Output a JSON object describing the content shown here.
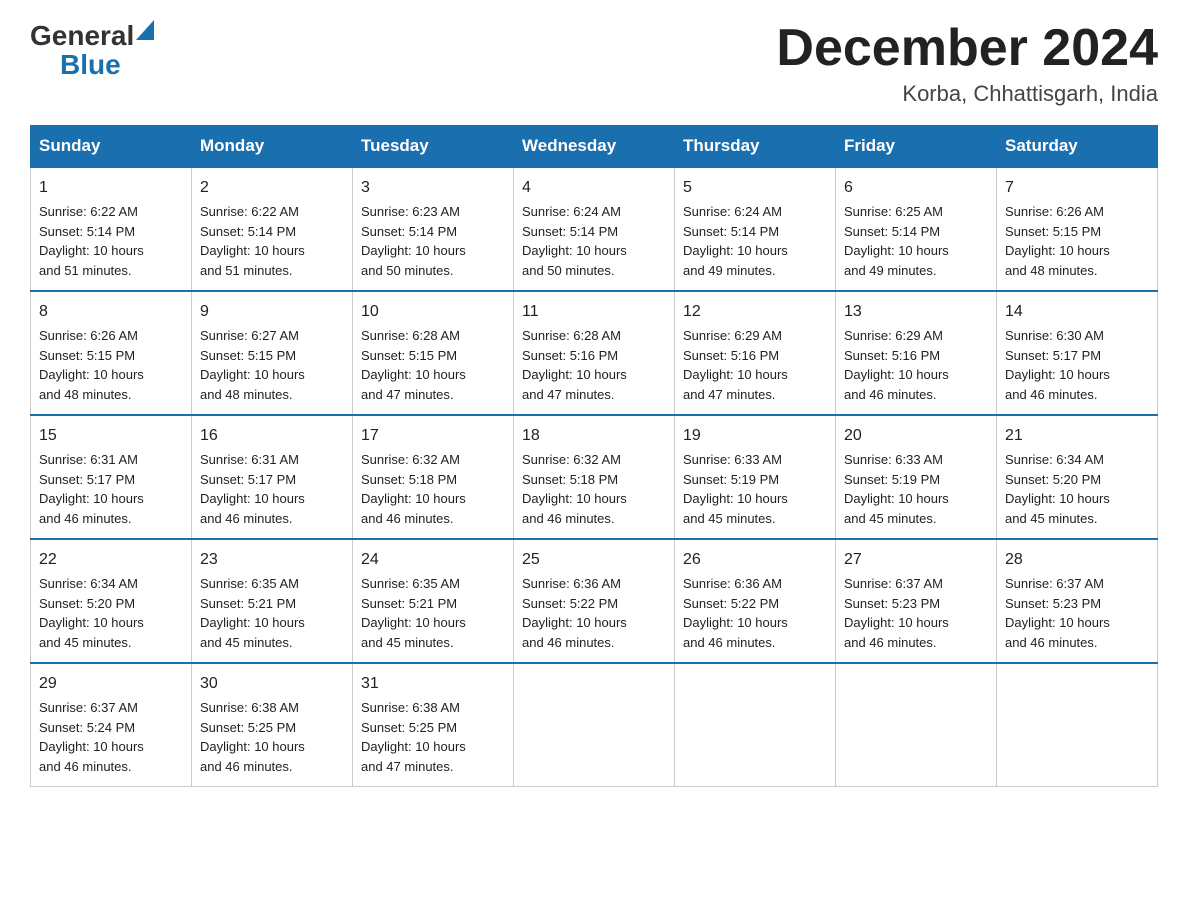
{
  "header": {
    "logo_general": "General",
    "logo_blue": "Blue",
    "title": "December 2024",
    "subtitle": "Korba, Chhattisgarh, India"
  },
  "days_of_week": [
    "Sunday",
    "Monday",
    "Tuesday",
    "Wednesday",
    "Thursday",
    "Friday",
    "Saturday"
  ],
  "weeks": [
    [
      {
        "day": "1",
        "sunrise": "6:22 AM",
        "sunset": "5:14 PM",
        "daylight": "10 hours and 51 minutes."
      },
      {
        "day": "2",
        "sunrise": "6:22 AM",
        "sunset": "5:14 PM",
        "daylight": "10 hours and 51 minutes."
      },
      {
        "day": "3",
        "sunrise": "6:23 AM",
        "sunset": "5:14 PM",
        "daylight": "10 hours and 50 minutes."
      },
      {
        "day": "4",
        "sunrise": "6:24 AM",
        "sunset": "5:14 PM",
        "daylight": "10 hours and 50 minutes."
      },
      {
        "day": "5",
        "sunrise": "6:24 AM",
        "sunset": "5:14 PM",
        "daylight": "10 hours and 49 minutes."
      },
      {
        "day": "6",
        "sunrise": "6:25 AM",
        "sunset": "5:14 PM",
        "daylight": "10 hours and 49 minutes."
      },
      {
        "day": "7",
        "sunrise": "6:26 AM",
        "sunset": "5:15 PM",
        "daylight": "10 hours and 48 minutes."
      }
    ],
    [
      {
        "day": "8",
        "sunrise": "6:26 AM",
        "sunset": "5:15 PM",
        "daylight": "10 hours and 48 minutes."
      },
      {
        "day": "9",
        "sunrise": "6:27 AM",
        "sunset": "5:15 PM",
        "daylight": "10 hours and 48 minutes."
      },
      {
        "day": "10",
        "sunrise": "6:28 AM",
        "sunset": "5:15 PM",
        "daylight": "10 hours and 47 minutes."
      },
      {
        "day": "11",
        "sunrise": "6:28 AM",
        "sunset": "5:16 PM",
        "daylight": "10 hours and 47 minutes."
      },
      {
        "day": "12",
        "sunrise": "6:29 AM",
        "sunset": "5:16 PM",
        "daylight": "10 hours and 47 minutes."
      },
      {
        "day": "13",
        "sunrise": "6:29 AM",
        "sunset": "5:16 PM",
        "daylight": "10 hours and 46 minutes."
      },
      {
        "day": "14",
        "sunrise": "6:30 AM",
        "sunset": "5:17 PM",
        "daylight": "10 hours and 46 minutes."
      }
    ],
    [
      {
        "day": "15",
        "sunrise": "6:31 AM",
        "sunset": "5:17 PM",
        "daylight": "10 hours and 46 minutes."
      },
      {
        "day": "16",
        "sunrise": "6:31 AM",
        "sunset": "5:17 PM",
        "daylight": "10 hours and 46 minutes."
      },
      {
        "day": "17",
        "sunrise": "6:32 AM",
        "sunset": "5:18 PM",
        "daylight": "10 hours and 46 minutes."
      },
      {
        "day": "18",
        "sunrise": "6:32 AM",
        "sunset": "5:18 PM",
        "daylight": "10 hours and 46 minutes."
      },
      {
        "day": "19",
        "sunrise": "6:33 AM",
        "sunset": "5:19 PM",
        "daylight": "10 hours and 45 minutes."
      },
      {
        "day": "20",
        "sunrise": "6:33 AM",
        "sunset": "5:19 PM",
        "daylight": "10 hours and 45 minutes."
      },
      {
        "day": "21",
        "sunrise": "6:34 AM",
        "sunset": "5:20 PM",
        "daylight": "10 hours and 45 minutes."
      }
    ],
    [
      {
        "day": "22",
        "sunrise": "6:34 AM",
        "sunset": "5:20 PM",
        "daylight": "10 hours and 45 minutes."
      },
      {
        "day": "23",
        "sunrise": "6:35 AM",
        "sunset": "5:21 PM",
        "daylight": "10 hours and 45 minutes."
      },
      {
        "day": "24",
        "sunrise": "6:35 AM",
        "sunset": "5:21 PM",
        "daylight": "10 hours and 45 minutes."
      },
      {
        "day": "25",
        "sunrise": "6:36 AM",
        "sunset": "5:22 PM",
        "daylight": "10 hours and 46 minutes."
      },
      {
        "day": "26",
        "sunrise": "6:36 AM",
        "sunset": "5:22 PM",
        "daylight": "10 hours and 46 minutes."
      },
      {
        "day": "27",
        "sunrise": "6:37 AM",
        "sunset": "5:23 PM",
        "daylight": "10 hours and 46 minutes."
      },
      {
        "day": "28",
        "sunrise": "6:37 AM",
        "sunset": "5:23 PM",
        "daylight": "10 hours and 46 minutes."
      }
    ],
    [
      {
        "day": "29",
        "sunrise": "6:37 AM",
        "sunset": "5:24 PM",
        "daylight": "10 hours and 46 minutes."
      },
      {
        "day": "30",
        "sunrise": "6:38 AM",
        "sunset": "5:25 PM",
        "daylight": "10 hours and 46 minutes."
      },
      {
        "day": "31",
        "sunrise": "6:38 AM",
        "sunset": "5:25 PM",
        "daylight": "10 hours and 47 minutes."
      },
      null,
      null,
      null,
      null
    ]
  ],
  "labels": {
    "sunrise": "Sunrise:",
    "sunset": "Sunset:",
    "daylight": "Daylight:"
  }
}
